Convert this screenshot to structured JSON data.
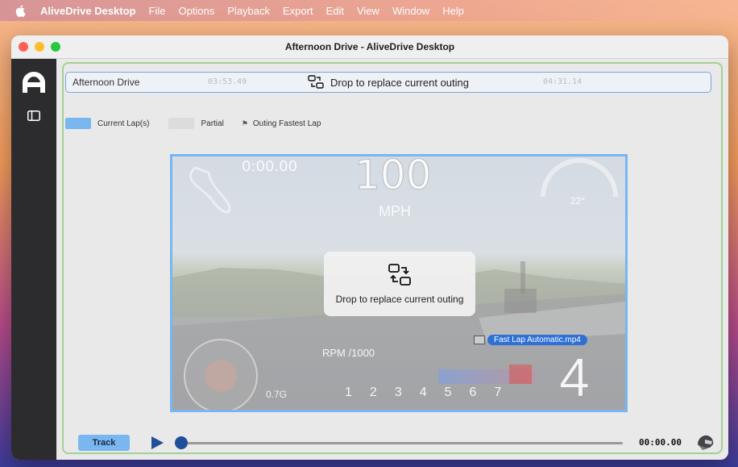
{
  "menubar": {
    "app_name": "AliveDrive Desktop",
    "items": [
      "File",
      "Options",
      "Playback",
      "Export",
      "Edit",
      "View",
      "Window",
      "Help"
    ]
  },
  "window": {
    "title": "Afternoon Drive - AliveDrive Desktop"
  },
  "outing_bar": {
    "name": "Afternoon Drive",
    "time_left": "03:53.49",
    "time_right": "04:31.14",
    "drop_text": "Drop to replace current outing"
  },
  "legend": {
    "current": "Current Lap(s)",
    "partial": "Partial",
    "fastest": "Outing Fastest Lap"
  },
  "video": {
    "hud_time": "0:00.00",
    "speed": "100",
    "unit": "MPH",
    "temp": "22°",
    "rpm_label": "RPM /1000",
    "g_force": "0.7G",
    "gears": [
      "1",
      "2",
      "3",
      "4",
      "5",
      "6",
      "7"
    ],
    "current_gear": "4"
  },
  "drop_overlay": {
    "label": "Drop to replace current outing"
  },
  "dragged_file": {
    "name": "Fast Lap Automatic.mp4"
  },
  "controls": {
    "track_label": "Track",
    "time": "00:00.00"
  },
  "colors": {
    "accent_blue": "#7ab6f0",
    "file_tag_blue": "#2f6fd6",
    "sidebar": "#2c2c2e"
  }
}
